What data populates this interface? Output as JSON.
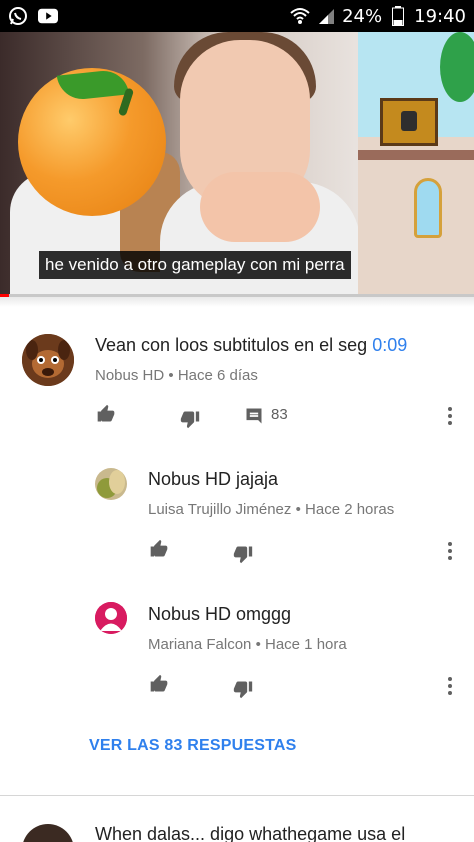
{
  "status_bar": {
    "battery": "24%",
    "time": "19:40",
    "icons": [
      "whatsapp-icon",
      "youtube-icon",
      "wifi-icon",
      "signal-icon",
      "battery-icon"
    ]
  },
  "video": {
    "caption": "he venido a otro gameplay con mi perra",
    "progress_fraction": 0.02
  },
  "comments": [
    {
      "text": "Vean con loos subtitulos en el seg ",
      "timestamp_link": "0:09",
      "author": "Nobus HD",
      "age": "Hace 6 días",
      "reply_count": "83"
    },
    {
      "text": "Nobus HD jajaja",
      "author": "Luisa Trujillo Jiménez",
      "age": "Hace 2 horas"
    },
    {
      "text": "Nobus HD omggg",
      "author": "Mariana Falcon",
      "age": "Hace 1 hora"
    }
  ],
  "view_replies_label": "VER LAS 83 RESPUESTAS",
  "next_comment": {
    "text": "When dalas... digo whathegame usa el"
  },
  "meta_separator": "•",
  "colors": {
    "accent_link": "#2f80ed",
    "progress": "#ff0000",
    "mariana_avatar": "#d81b60"
  }
}
